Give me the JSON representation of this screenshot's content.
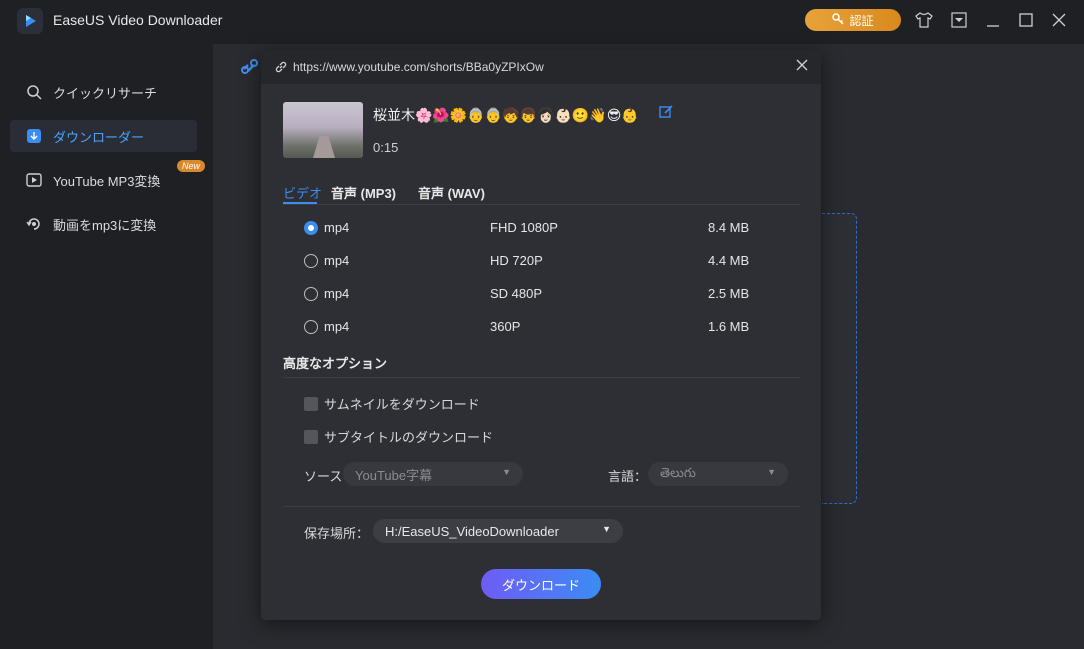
{
  "app": {
    "title": "EaseUS Video Downloader",
    "auth_label": "認証"
  },
  "sidebar": {
    "items": [
      {
        "label": "クイックリサーチ",
        "icon": "search-icon"
      },
      {
        "label": "ダウンローダー",
        "icon": "download-icon"
      },
      {
        "label": "YouTube MP3変換",
        "icon": "play-icon",
        "badge": "New"
      },
      {
        "label": "動画をmp3に変換",
        "icon": "convert-icon"
      }
    ]
  },
  "dialog": {
    "url": "https://www.youtube.com/shorts/BBa0yZPIxOw",
    "video_title": "桜並木🌸🌺🌼👵👵🧒👦👩🏻👶🏻🙂👋😎👶",
    "duration": "0:15",
    "tabs": [
      "ビデオ",
      "音声 (MP3)",
      "音声 (WAV)"
    ],
    "formats": [
      {
        "name": "mp4",
        "resolution": "FHD 1080P",
        "size": "8.4 MB",
        "selected": true
      },
      {
        "name": "mp4",
        "resolution": "HD 720P",
        "size": "4.4 MB",
        "selected": false
      },
      {
        "name": "mp4",
        "resolution": "SD 480P",
        "size": "2.5 MB",
        "selected": false
      },
      {
        "name": "mp4",
        "resolution": "360P",
        "size": "1.6 MB",
        "selected": false
      }
    ],
    "advanced": {
      "title": "高度なオプション",
      "thumbnail_label": "サムネイルをダウンロード",
      "subtitle_label": "サブタイトルのダウンロード",
      "source_label": "ソース",
      "source_value": "YouTube字幕",
      "language_label": "言語：",
      "language_value": "తెలుగు"
    },
    "save": {
      "label": "保存場所：",
      "path": "H:/EaseUS_VideoDownloader"
    },
    "download_label": "ダウンロード"
  },
  "colors": {
    "accent": "#3b8cf3",
    "auth": "#e8a23a",
    "background": "#1f2024",
    "dialog": "#2e2f34"
  }
}
